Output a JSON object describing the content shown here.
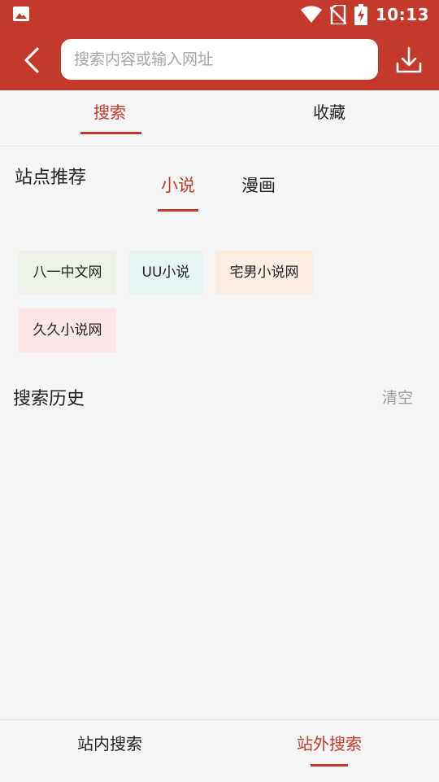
{
  "status_bar": {
    "time": "10:13",
    "icons": [
      "gallery-icon",
      "wifi-icon",
      "no-sim-icon",
      "battery-charging-icon"
    ]
  },
  "header": {
    "back_icon": "back-arrow-icon",
    "search_placeholder": "搜索内容或输入网址",
    "search_value": "",
    "download_icon": "download-icon"
  },
  "tabs": [
    {
      "label": "搜索",
      "active": true
    },
    {
      "label": "收藏",
      "active": false
    }
  ],
  "site_recommend": {
    "title": "站点推荐",
    "categories": [
      {
        "label": "小说",
        "active": true
      },
      {
        "label": "漫画",
        "active": false
      }
    ],
    "sites": [
      {
        "label": "八一中文网",
        "bg": "#edf3e6"
      },
      {
        "label": "UU小说",
        "bg": "#e7f4f4"
      },
      {
        "label": "宅男小说网",
        "bg": "#fbede2"
      },
      {
        "label": "久久小说网",
        "bg": "#fbe7e7"
      }
    ]
  },
  "history": {
    "title": "搜索历史",
    "clear_label": "清空"
  },
  "bottom_nav": [
    {
      "label": "站内搜索",
      "active": false
    },
    {
      "label": "站外搜索",
      "active": true
    }
  ],
  "colors": {
    "accent": "#c3392b",
    "background": "#f6f6f6",
    "text": "#222222",
    "muted": "#9b9b9b"
  }
}
